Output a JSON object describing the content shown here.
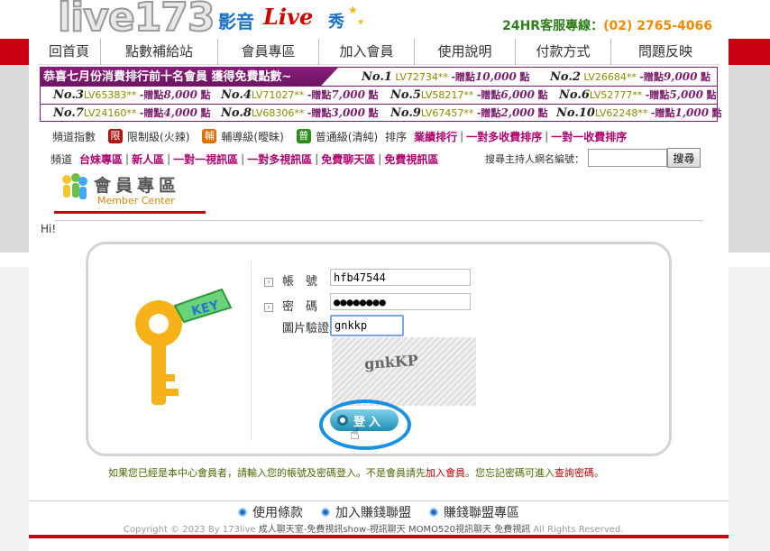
{
  "header": {
    "logo_text": "live173",
    "logo_sub": "影音",
    "logo_live": "Live",
    "logo_xiu": "秀",
    "hotline_label": "24HR客服專線：",
    "hotline_number": "(02) 2765-4066"
  },
  "nav": {
    "items": [
      {
        "label": "回首頁"
      },
      {
        "label": "點數補給站"
      },
      {
        "label": "會員專區"
      },
      {
        "label": "加入會員"
      },
      {
        "label": "使用說明"
      },
      {
        "label": "付款方式"
      },
      {
        "label": "問題反映"
      }
    ]
  },
  "ranking": {
    "title": "恭喜七月份消費排行前十名會員 獲得免費點數~",
    "gift_label": "-贈點",
    "unit": "點",
    "entries": [
      {
        "no": "No.1",
        "lv": "LV72734**",
        "pts": "10,000"
      },
      {
        "no": "No.2",
        "lv": "LV26684**",
        "pts": "9,000"
      },
      {
        "no": "No.3",
        "lv": "LV65383**",
        "pts": "8,000"
      },
      {
        "no": "No.4",
        "lv": "LV71027**",
        "pts": "7,000"
      },
      {
        "no": "No.5",
        "lv": "LV58217**",
        "pts": "6,000"
      },
      {
        "no": "No.6",
        "lv": "LV52777**",
        "pts": "5,000"
      },
      {
        "no": "No.7",
        "lv": "LV24160**",
        "pts": "4,000"
      },
      {
        "no": "No.8",
        "lv": "LV68306**",
        "pts": "3,000"
      },
      {
        "no": "No.9",
        "lv": "LV67457**",
        "pts": "2,000"
      },
      {
        "no": "No.10",
        "lv": "LV62248**",
        "pts": "1,000"
      }
    ]
  },
  "channels": {
    "index_label": "頻道指數",
    "levels": [
      {
        "badge": "限",
        "label": "限制級(火辣)"
      },
      {
        "badge": "輔",
        "label": "輔導級(曖昧)"
      },
      {
        "badge": "普",
        "label": "普通級(清純)"
      }
    ],
    "sort_label": "排序",
    "sort_links": [
      "業績排行",
      "一對多收費排序",
      "一對一收費排序"
    ],
    "channel_label": "頻道",
    "channel_links": [
      "台妹專區",
      "新人區",
      "一對一視訊區",
      "一對多視訊區",
      "免費聊天區",
      "免費視訊區"
    ],
    "search_label": "搜尋主持人網名編號：",
    "search_value": "",
    "search_button": "搜尋"
  },
  "member_center": {
    "title": "會員專區",
    "subtitle": "Member Center"
  },
  "greeting": "Hi!",
  "login": {
    "account_label": "帳　號",
    "account_value": "hfb47544",
    "password_label": "密　碼",
    "password_value": "●●●●●●●●",
    "captcha_label": "圖片驗證",
    "captcha_value": "gnkkp",
    "captcha_image_text": "gnkKP",
    "key_text": "KEY",
    "login_button": "登入"
  },
  "notice": {
    "part1": "如果您已經是本中心會員者，請輸入您的帳號及密碼登入。不是會員請先",
    "join": "加入會員",
    "part2": "。您忘記密碼可進入",
    "query": "查詢密碼",
    "part3": "。"
  },
  "footer": {
    "links": [
      "使用條款",
      "加入賺錢聯盟",
      "賺錢聯盟專區"
    ],
    "copyright_pre": "Copyright © 2023 By 173live",
    "copyright_mid": "成人聊天室-免費視訊show-視訊聊天 MOMO520視訊聊天 免費視訊",
    "copyright_post": "All Rights Reserved."
  },
  "colors": {
    "brand_red": "#c8000f",
    "rank_purple": "#7b1f6e",
    "link_magenta": "#b0006e",
    "hotline_orange": "#f08a00"
  }
}
